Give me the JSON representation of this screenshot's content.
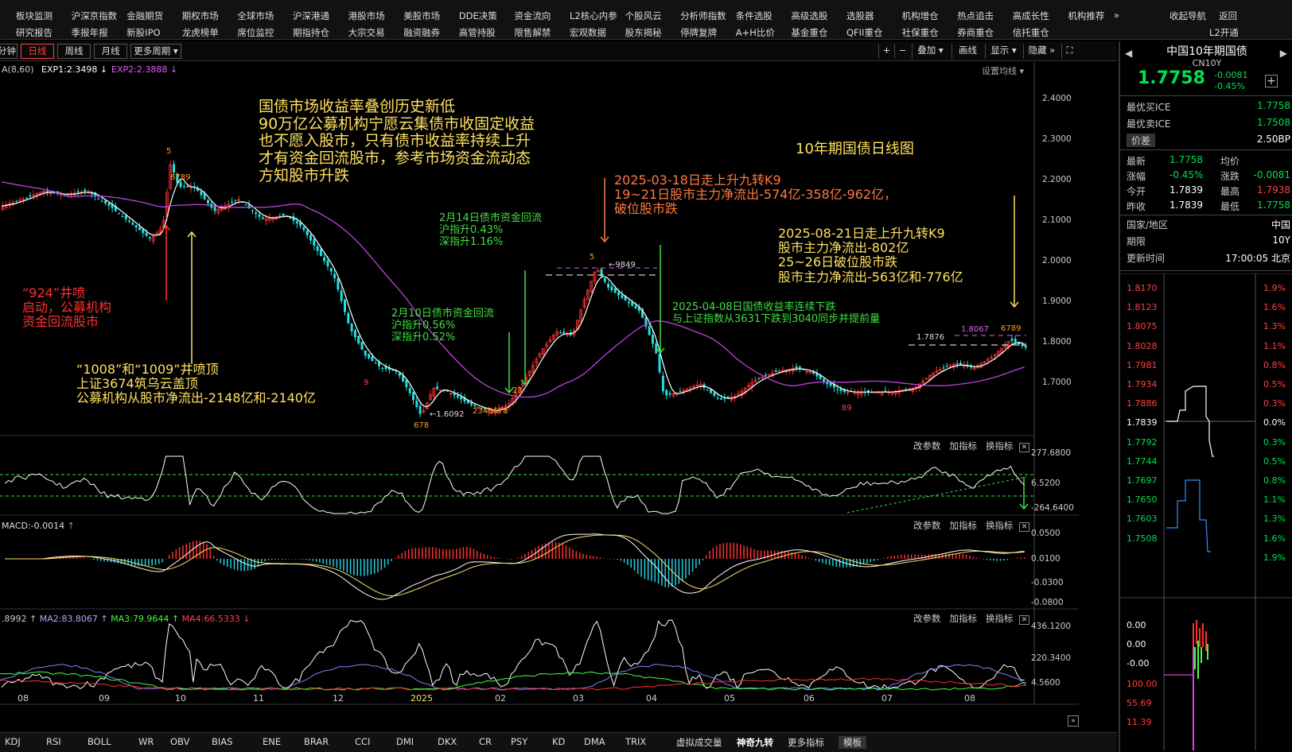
{
  "menu": {
    "row1": [
      "板块监测",
      "沪深京指数",
      "金融期货",
      "期权市场",
      "全球市场",
      "沪深港通",
      "港股市场",
      "美股市场",
      "DDE决策",
      "资金流向",
      "L2核心内参",
      "个股风云",
      "分析师指数",
      "条件选股",
      "高级选股",
      "选股器",
      "机构增仓",
      "热点追击",
      "高成长性",
      "机构推荐"
    ],
    "row2": [
      "研究报告",
      "季报年报",
      "新股IPO",
      "龙虎榜单",
      "席位监控",
      "期指持仓",
      "大宗交易",
      "融资融券",
      "高管持股",
      "限售解禁",
      "宏观数据",
      "股东揭秘",
      "停牌复牌",
      "A+H比价",
      "基金重仓",
      "QFII重仓",
      "社保重仓",
      "券商重仓",
      "信托重仓"
    ],
    "more": "»",
    "collapse_nav": "收起导航",
    "back": "返回",
    "l2": "L2开通"
  },
  "toolbar": {
    "minute": "分钟",
    "daily": "日线",
    "weekly": "周线",
    "monthly": "月线",
    "more_periods": "更多周期",
    "plus": "+",
    "minus": "−",
    "overlay": "叠加",
    "draw": "画线",
    "show": "显示",
    "hide": "隐藏",
    "more": "»",
    "expand": "⛶"
  },
  "legend": {
    "ma": "A(8,60)",
    "exp1": "EXP1:2.3498",
    "exp2": "EXP2:2.3888",
    "setup": "设置均线"
  },
  "annotations": {
    "main_title": "国债市场收益率叠创历史新低\n90万亿公募机构宁愿云集债市收固定收益\n也不愿入股市，只有债市收益率持续上升\n才有资金回流股市，参考市场资金流动态\n方知股市升跌",
    "chart_title": "10年期国债日线图",
    "a0318": "2025-03-18日走上升九转K9\n19~21日股市主力净流出-574亿-358亿-962亿，\n破位股市跌",
    "a0214": "2月14日债市资金回流\n沪指升0.43%\n深指升1.16%",
    "a0821": "2025-08-21日走上升九转K9\n股市主力净流出-802亿\n25~26日破位股市跌\n股市主力净流出-563亿和-776亿",
    "a924": "“924”井喷\n启动，公募机构\n资金回流股市",
    "a0408": "2025-04-08日国债收益率连续下跌\n与上证指数从3631下跌到3040同步并提前量",
    "a0210": "2月10日债市资金回流\n沪指升0.56%\n深指升0.52%",
    "a1008": "“1008”和“1009”井喷顶\n上证3674筑乌云盖顶\n公募机构从股市净流出-2148亿和-2140亿"
  },
  "price_labels": {
    "low": "1.6092",
    "high": "9849",
    "level1": "1.7876",
    "level2": "1.8067"
  },
  "nine_labels": {
    "n5": "5",
    "n6789a": "6789",
    "n9": "9",
    "n89": "89",
    "n678": "678",
    "n2345678": "2345678",
    "n23": "23",
    "n4": "4",
    "n5b": "5",
    "n1": "1"
  },
  "yaxis_main": [
    "2.4000",
    "2.3000",
    "2.2000",
    "2.1000",
    "2.0000",
    "1.9000",
    "1.8000",
    "1.7000"
  ],
  "panel_tools": {
    "change": "改参数",
    "add": "加指标",
    "swap": "换指标",
    "close": "✕"
  },
  "cci": {
    "axis": [
      "277.6800",
      "6.5200",
      "-264.6400"
    ]
  },
  "macd": {
    "label": "MACD:-0.0014",
    "axis": [
      "0.0500",
      "0.0100",
      "-0.0300",
      "-0.0800"
    ]
  },
  "ma_panel": {
    "ma1": ".8992",
    "ma2": "MA2:83.8067",
    "ma3": "MA3:79.9644",
    "ma4": "MA4:66.5333",
    "axis": [
      "436.1200",
      "220.3400",
      "4.5600"
    ]
  },
  "xaxis": [
    "08",
    "09",
    "10",
    "11",
    "12",
    "2025",
    "02",
    "03",
    "04",
    "05",
    "06",
    "07",
    "08"
  ],
  "bottom": [
    "KDJ",
    "RSI",
    "BOLL",
    "WR",
    "OBV",
    "BIAS",
    "ENE",
    "BRAR",
    "CCI",
    "DMI",
    "DKX",
    "CR",
    "PSY",
    "KD",
    "DMA",
    "TRIX",
    "虚拟成交量",
    "神奇九转",
    "更多指标",
    "模板"
  ],
  "right_panel": {
    "name": "中国10年期国债",
    "code": "CN10Y",
    "price": "1.7758",
    "chg": "-0.0081",
    "pct": "-0.45%",
    "rows": [
      {
        "l": "最优买ICE",
        "v": "1.7758"
      },
      {
        "l": "最优卖ICE",
        "v": "1.7508"
      },
      {
        "l": "价差",
        "v": "2.50BP"
      }
    ],
    "grid": [
      {
        "l1": "最新",
        "v1": "1.7758",
        "l2": "均价",
        "v2": ""
      },
      {
        "l1": "涨幅",
        "v1": "-0.45%",
        "l2": "涨跌",
        "v2": "-0.0081"
      },
      {
        "l1": "今开",
        "v1": "1.7839",
        "l2": "最高",
        "v2": "1.7938"
      },
      {
        "l1": "昨收",
        "v1": "1.7839",
        "l2": "最低",
        "v2": "1.7758"
      }
    ],
    "info": [
      {
        "l": "国家/地区",
        "v": "中国"
      },
      {
        "l": "期限",
        "v": "10Y"
      },
      {
        "l": "更新时间",
        "v": "17:00:05 北京"
      }
    ],
    "mini_left": [
      "1.8170",
      "1.8123",
      "1.8075",
      "1.8028",
      "1.7981",
      "1.7934",
      "1.7886",
      "1.7839",
      "1.7792",
      "1.7744",
      "1.7697",
      "1.7650",
      "1.7603",
      "1.7508"
    ],
    "mini_right": [
      "1.9%",
      "1.6%",
      "1.3%",
      "1.1%",
      "0.8%",
      "0.5%",
      "0.3%",
      "0.0%",
      "0.3%",
      "0.5%",
      "0.8%",
      "1.1%",
      "1.3%",
      "1.6%",
      "1.9%"
    ],
    "vol_left": [
      "0.00",
      "0.00",
      "-0.00",
      "100.00",
      "55.69",
      "11.39"
    ]
  }
}
